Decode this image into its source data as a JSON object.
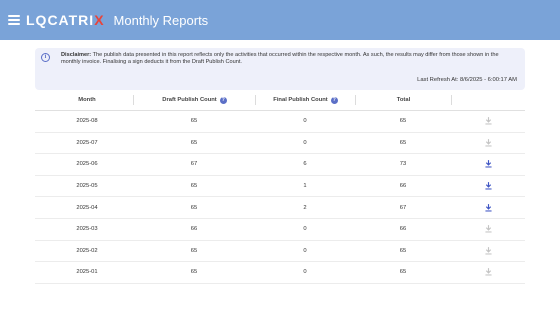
{
  "header": {
    "logo_main": "LQCATRI",
    "logo_x": "X",
    "title": "Monthly Reports"
  },
  "disclaimer": {
    "label": "Disclaimer:",
    "text": " The publish data presented in this report reflects only the activities that occurred within the respective month. As such, the results may differ from those shown in the monthly invoice. Finalising a sign deducts it from the Draft Publish Count.",
    "last_refresh": "Last Refresh At: 8/6/2025 - 6:00:17 AM"
  },
  "table": {
    "headers": [
      "Month",
      "Draft Publish Count",
      "Final Publish Count",
      "Total"
    ],
    "rows": [
      {
        "month": "2025-08",
        "draft": "65",
        "final": "0",
        "total": "65",
        "download_enabled": false
      },
      {
        "month": "2025-07",
        "draft": "65",
        "final": "0",
        "total": "65",
        "download_enabled": false
      },
      {
        "month": "2025-06",
        "draft": "67",
        "final": "6",
        "total": "73",
        "download_enabled": true
      },
      {
        "month": "2025-05",
        "draft": "65",
        "final": "1",
        "total": "66",
        "download_enabled": true
      },
      {
        "month": "2025-04",
        "draft": "65",
        "final": "2",
        "total": "67",
        "download_enabled": true
      },
      {
        "month": "2025-03",
        "draft": "66",
        "final": "0",
        "total": "66",
        "download_enabled": false
      },
      {
        "month": "2025-02",
        "draft": "65",
        "final": "0",
        "total": "65",
        "download_enabled": false
      },
      {
        "month": "2025-01",
        "draft": "65",
        "final": "0",
        "total": "65",
        "download_enabled": false
      }
    ]
  },
  "colors": {
    "header_bg": "#7aa3d8",
    "accent": "#5b6fc7",
    "download_enabled": "#3f55c4",
    "download_disabled": "#c4c4c4"
  }
}
